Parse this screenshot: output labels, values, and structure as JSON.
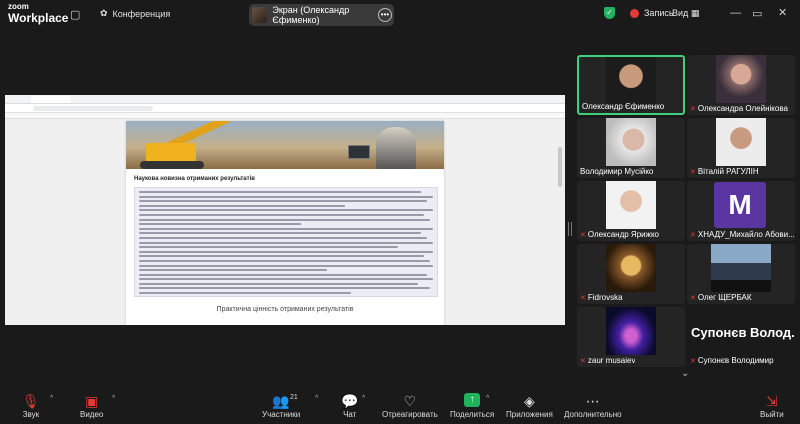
{
  "app": {
    "logo_line1": "zoom",
    "logo_line2": "Workplace"
  },
  "topbar": {
    "conference_label": "Конференция",
    "screen_label": "Экран (Олександр Єфименко)",
    "record_label": "Запись",
    "view_label": "Вид"
  },
  "shared_doc": {
    "section_title": "Наукова новизна отриманих результатів",
    "subtitle": "Практична цінність отриманих результатів"
  },
  "participants": [
    {
      "name": "Олександр Єфименко",
      "active": true
    },
    {
      "name": "Олександра Олейнікова",
      "muted": true
    },
    {
      "name": "Володимир Мусійко"
    },
    {
      "name": "Віталій РАГУЛІН",
      "muted": true
    },
    {
      "name": "Олександр Ярижко",
      "muted": true
    },
    {
      "name": "ХНАДУ_Михайло Абови...",
      "muted": true,
      "avatar_letter": "M"
    },
    {
      "name": "Fidrovska",
      "muted": true
    },
    {
      "name": "Олег ЩЕРБАК",
      "muted": true
    },
    {
      "name": "zaur musaiev",
      "muted": true
    },
    {
      "name": "Супонєв Володимир",
      "muted": true,
      "big_label": "Супонєв Волод..."
    }
  ],
  "toolbar": {
    "audio": "Звук",
    "video": "Видео",
    "participants": "Участники",
    "participants_count": "21",
    "chat": "Чат",
    "react": "Отреагировать",
    "share": "Поделиться",
    "apps": "Приложения",
    "more": "Дополнительно",
    "leave": "Выйти"
  },
  "colors": {
    "accent_green": "#1fb45a",
    "mute_red": "#e53935",
    "active_border": "#3fcf7d"
  }
}
